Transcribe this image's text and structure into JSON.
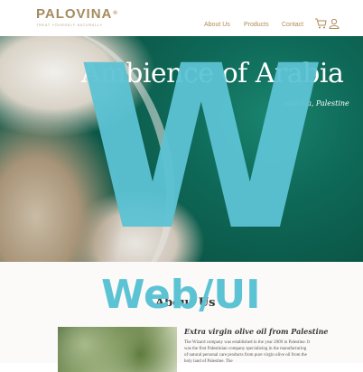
{
  "brand": {
    "name": "PALOVINA",
    "registered": "®",
    "tagline": "TREAT YOURSELF NATURALLY"
  },
  "nav": {
    "items": [
      "About Us",
      "Products",
      "Contact"
    ],
    "cart_icon": "cart-icon",
    "user_icon": "user-icon"
  },
  "hero": {
    "title": "Ambience of Arabia",
    "subtitle": "maralla, Palestine"
  },
  "watermark": {
    "letter": "W",
    "text": "Web/UI"
  },
  "about": {
    "heading": "About Us",
    "olive_heading": "Extra virgin olive oil from Palestine",
    "body": "The Wizard company was established in the year 2009 in Palestine. It was the first Palestinian company specializing in the manufacturing of natural personal care products from pure virgin olive oil from the holy land of Palestine. The"
  },
  "colors": {
    "brand": "#a48b5f",
    "nav": "#b08a55",
    "watermark": "#5cc3d4",
    "sea": "#0f6b5a"
  }
}
